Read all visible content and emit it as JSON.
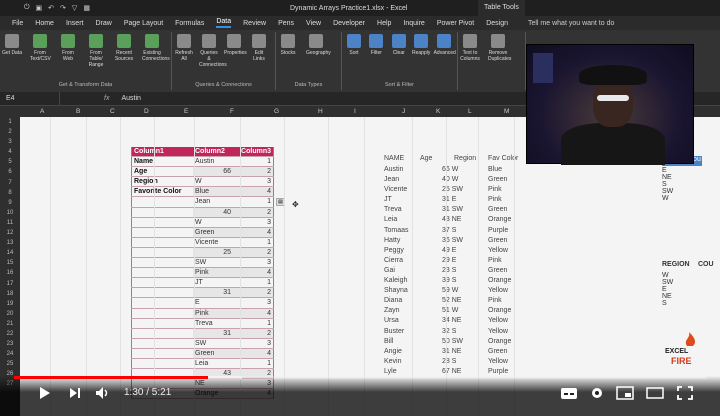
{
  "excel": {
    "title": "Dynamic Arrays Practice1.xlsx - Excel",
    "tabletools": "Table Tools",
    "menu": [
      "File",
      "Home",
      "Insert",
      "Draw",
      "Page Layout",
      "Formulas",
      "Data",
      "Review",
      "Pens",
      "View",
      "Developer",
      "Help",
      "Inquire",
      "Power Pivot",
      "Design"
    ],
    "active_menu": "Data",
    "tell_me": "Tell me what you want to do",
    "ribbon_groups": [
      {
        "label": "Get & Transform Data",
        "buttons": [
          "Get Data",
          "From Text/CSV",
          "From Web",
          "From Table/ Range",
          "Recent Sources",
          "Existing Connections"
        ]
      },
      {
        "label": "Queries & Connections",
        "buttons": [
          "Refresh All",
          "Queries & Connections",
          "Properties",
          "Edit Links"
        ]
      },
      {
        "label": "Data Types",
        "buttons": [
          "Stocks",
          "Geography"
        ]
      },
      {
        "label": "Sort & Filter",
        "buttons": [
          "Sort",
          "Filter",
          "Clear",
          "Reapply",
          "Advanced"
        ]
      },
      {
        "label": "",
        "buttons": [
          "Text to Columns",
          "Remove Duplicates"
        ]
      }
    ],
    "name_box": "E4",
    "formula_value": "Austin",
    "columns": [
      "A",
      "B",
      "C",
      "D",
      "E",
      "F",
      "G",
      "H",
      "I",
      "J",
      "K",
      "L",
      "M"
    ],
    "rows": [
      "1",
      "2",
      "3",
      "4",
      "5",
      "6",
      "7",
      "8",
      "9",
      "10",
      "11",
      "12",
      "13",
      "14",
      "15",
      "16",
      "17",
      "18",
      "19",
      "20",
      "21",
      "22",
      "23",
      "24",
      "25",
      "26",
      "27"
    ]
  },
  "table": {
    "headers": [
      "Column1",
      "Column2",
      "Column3"
    ],
    "rows": [
      [
        "Name",
        "Austin",
        "1"
      ],
      [
        "Age",
        "66",
        "2"
      ],
      [
        "Region",
        "W",
        "3"
      ],
      [
        "Favorite Color",
        "Blue",
        "4"
      ],
      [
        "",
        "Jean",
        "1"
      ],
      [
        "",
        "40",
        "2"
      ],
      [
        "",
        "W",
        "3"
      ],
      [
        "",
        "Green",
        "4"
      ],
      [
        "",
        "Vicente",
        "1"
      ],
      [
        "",
        "25",
        "2"
      ],
      [
        "",
        "SW",
        "3"
      ],
      [
        "",
        "Pink",
        "4"
      ],
      [
        "",
        "JT",
        "1"
      ],
      [
        "",
        "31",
        "2"
      ],
      [
        "",
        "E",
        "3"
      ],
      [
        "",
        "Pink",
        "4"
      ],
      [
        "",
        "Treva",
        "1"
      ],
      [
        "",
        "31",
        "2"
      ],
      [
        "",
        "SW",
        "3"
      ],
      [
        "",
        "Green",
        "4"
      ],
      [
        "",
        "Leia",
        "1"
      ],
      [
        "",
        "43",
        "2"
      ],
      [
        "",
        "NE",
        "3"
      ],
      [
        "",
        "Orange",
        "4"
      ]
    ]
  },
  "list": {
    "headers": [
      "NAME",
      "Age",
      "Region",
      "Fav Color"
    ],
    "rows": [
      [
        "Austin",
        "66 W",
        "Blue"
      ],
      [
        "Jean",
        "40 W",
        "Green"
      ],
      [
        "Vicente",
        "25 SW",
        "Pink"
      ],
      [
        "JT",
        "31 E",
        "Pink"
      ],
      [
        "Treva",
        "31 SW",
        "Green"
      ],
      [
        "Leia",
        "43 NE",
        "Orange"
      ],
      [
        "Tomaas",
        "37 S",
        "Purple"
      ],
      [
        "Hatty",
        "36 SW",
        "Green"
      ],
      [
        "Peggy",
        "49 E",
        "Yellow"
      ],
      [
        "Cierra",
        "29 E",
        "Pink"
      ],
      [
        "Gai",
        "23 S",
        "Green"
      ],
      [
        "Kaleigh",
        "39 S",
        "Orange"
      ],
      [
        "Shayna",
        "59 W",
        "Yellow"
      ],
      [
        "Diana",
        "52 NE",
        "Pink"
      ],
      [
        "Zayn",
        "51 W",
        "Orange"
      ],
      [
        "Ursa",
        "34 NE",
        "Yellow"
      ],
      [
        "Buster",
        "32 S",
        "Yellow"
      ],
      [
        "Bill",
        "50 SW",
        "Orange"
      ],
      [
        "Angie",
        "31 NE",
        "Green"
      ],
      [
        "Kevin",
        "28 S",
        "Yellow"
      ],
      [
        "Lyle",
        "67 NE",
        "Purple"
      ]
    ]
  },
  "right_column": {
    "top_label": "Cou",
    "items_top": [
      "E",
      "NE",
      "S",
      "SW",
      "W"
    ],
    "region_header": "REGION",
    "count_header": "COU",
    "items_bottom": [
      "W",
      "SW",
      "E",
      "NE",
      "S"
    ]
  },
  "logo": {
    "line1": "EXCEL",
    "line2": "FIRE"
  },
  "player": {
    "time_current": "1:30",
    "time_total": "5:21",
    "time_display": "1:30 / 5:21",
    "progress_fraction": 0.28,
    "loaded_fraction": 0.33,
    "accent_color": "#ff0000"
  }
}
